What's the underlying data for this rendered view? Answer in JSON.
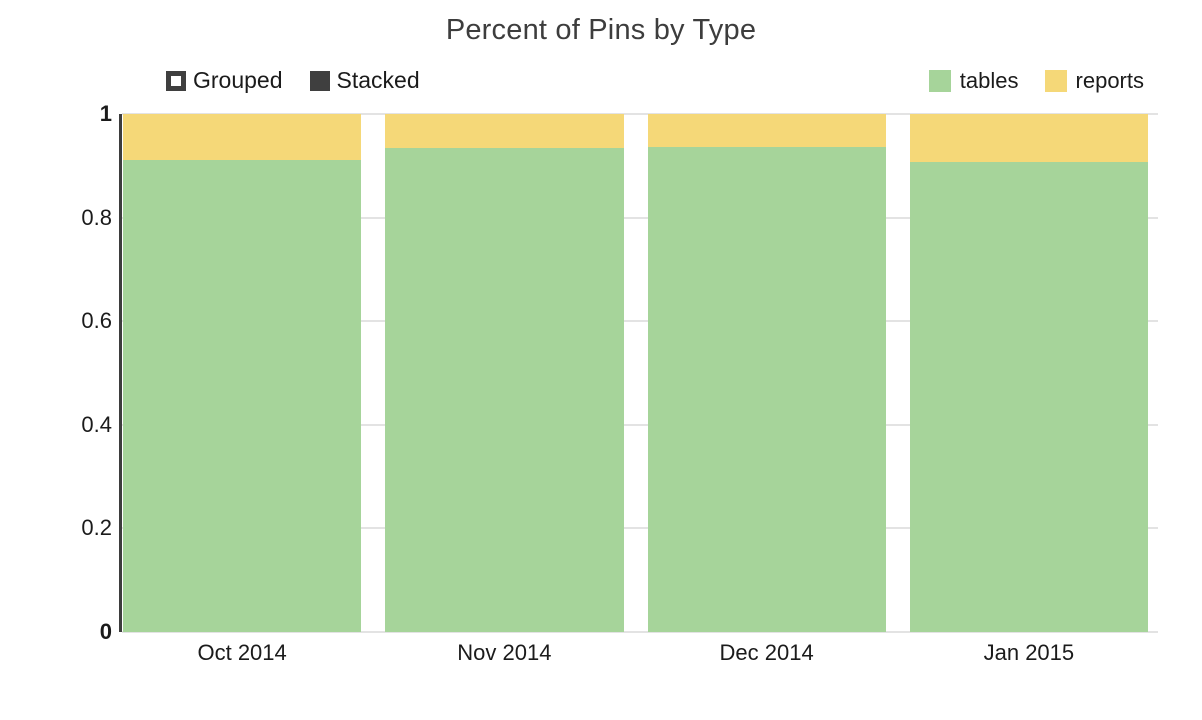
{
  "chart_data": {
    "type": "bar",
    "subtype": "stacked-100-percent",
    "title": "Percent of Pins by Type",
    "xlabel": "",
    "ylabel": "",
    "categories": [
      "Oct 2014",
      "Nov 2014",
      "Dec 2014",
      "Jan 2015"
    ],
    "series": [
      {
        "name": "tables",
        "color": "#a6d49a",
        "values": [
          0.911,
          0.934,
          0.936,
          0.907
        ]
      },
      {
        "name": "reports",
        "color": "#f5d878",
        "values": [
          0.089,
          0.066,
          0.064,
          0.093
        ]
      }
    ],
    "ylim": [
      0,
      1
    ],
    "yticks": [
      "0",
      "0.2",
      "0.4",
      "0.6",
      "0.8",
      "1"
    ],
    "ytick_values": [
      0,
      0.2,
      0.4,
      0.6,
      0.8,
      1
    ],
    "grid": true,
    "legend_position": "top-right",
    "stack_order": [
      "tables",
      "reports"
    ]
  },
  "mode_toggle": {
    "options": [
      {
        "label": "Grouped",
        "selected": false
      },
      {
        "label": "Stacked",
        "selected": true
      }
    ]
  },
  "colors": {
    "tables": "#a6d49a",
    "reports": "#f5d878",
    "title_text": "#3d3d3d",
    "axis": "#3d3d3d",
    "gridline": "#e3e3e3",
    "toggle": "#3f3f3f",
    "background": "#ffffff"
  }
}
